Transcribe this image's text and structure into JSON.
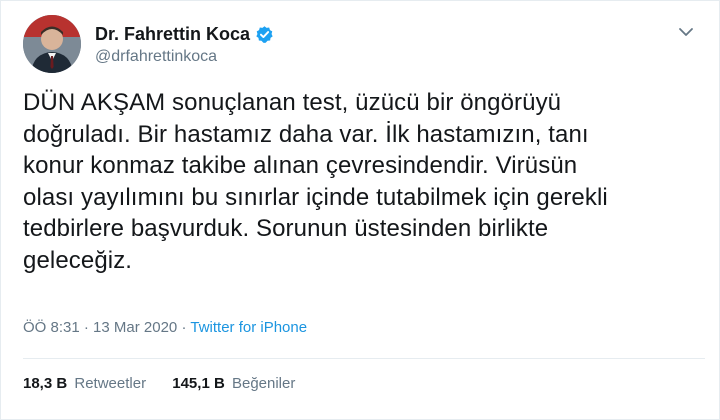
{
  "tweet": {
    "author": {
      "display_name": "Dr. Fahrettin Koca",
      "handle": "@drfahrettinkoca",
      "verified": true
    },
    "text_lines": [
      "DÜN AKŞAM sonuçlanan test, üzücü bir öngörüyü",
      "doğruladı. Bir hastamız daha var. İlk hastamızın, tanı",
      "konur konmaz takibe alınan çevresindendir. Virüsün",
      "olası yayılımını bu sınırlar içinde tutabilmek için gerekli",
      "tedbirlere başvurduk. Sorunun üstesinden birlikte",
      "geleceğiz."
    ],
    "time": "ÖÖ 8:31",
    "separator": "·",
    "date": "13 Mar 2020",
    "source": "Twitter for iPhone",
    "stats": {
      "retweets_count": "18,3 B",
      "retweets_label": "Retweetler",
      "likes_count": "145,1 B",
      "likes_label": "Beğeniler"
    }
  },
  "icons": {
    "verified": "verified-badge-icon",
    "caret": "chevron-down-icon"
  },
  "colors": {
    "text": "#14171a",
    "secondary": "#657786",
    "link": "#1b95e0",
    "verified": "#1da1f2",
    "divider": "#e6ecf0"
  }
}
